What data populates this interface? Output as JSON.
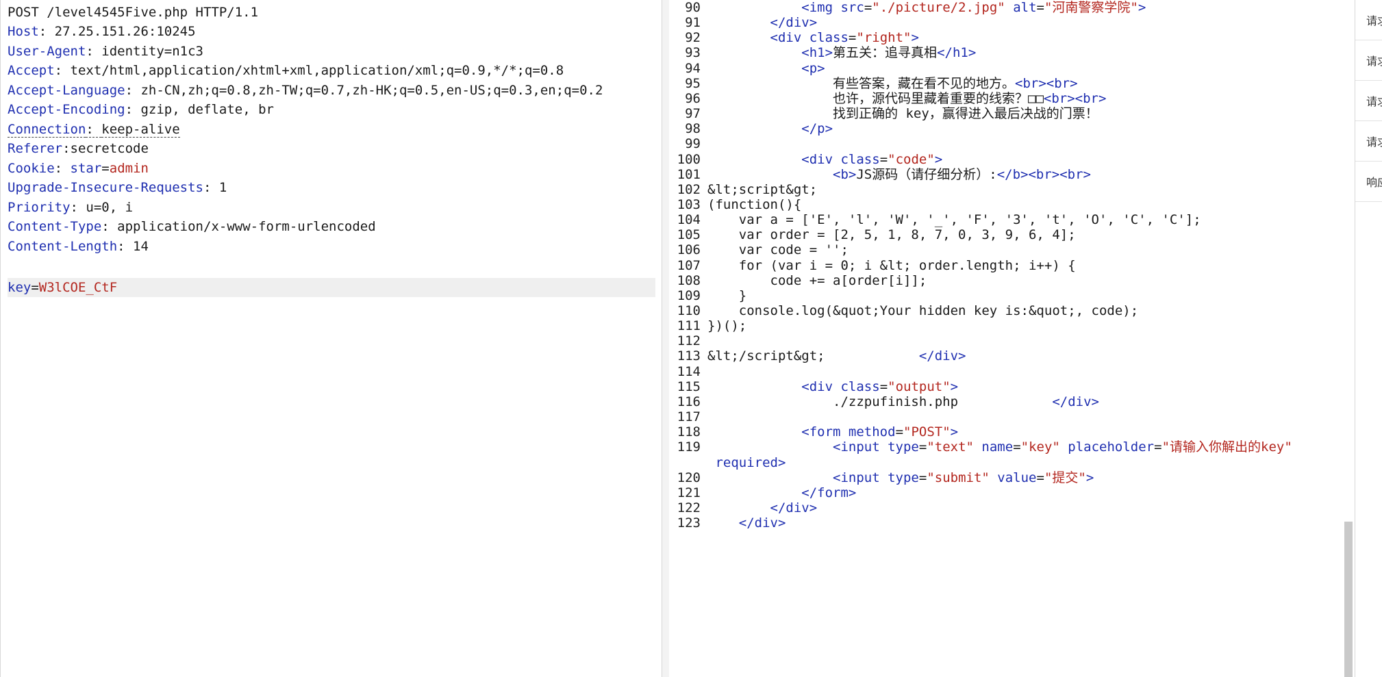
{
  "request": {
    "request_line": "POST /level4545Five.php HTTP/1.1",
    "headers": [
      {
        "name": "Host",
        "sep": ": ",
        "value": "27.25.151.26:10245"
      },
      {
        "name": "User-Agent",
        "sep": ": ",
        "value": "identity=n1c3"
      },
      {
        "name": "Accept",
        "sep": ": ",
        "value": "text/html,application/xhtml+xml,application/xml;q=0.9,*/*;q=0.8"
      },
      {
        "name": "Accept-Language",
        "sep": ": ",
        "value": "zh-CN,zh;q=0.8,zh-TW;q=0.7,zh-HK;q=0.5,en-US;q=0.3,en;q=0.2"
      },
      {
        "name": "Accept-Encoding",
        "sep": ": ",
        "value": "gzip, deflate, br"
      },
      {
        "name": "Connection",
        "sep": ": ",
        "value": "keep-alive"
      },
      {
        "name": "Referer",
        "sep": ":",
        "value": "secretcode"
      },
      {
        "name": "Cookie",
        "sep": ": ",
        "value": "star=admin"
      },
      {
        "name": "Upgrade-Insecure-Requests",
        "sep": ": ",
        "value": "1"
      },
      {
        "name": "Priority",
        "sep": ": ",
        "value": "u=0, i"
      },
      {
        "name": "Content-Type",
        "sep": ": ",
        "value": "application/x-www-form-urlencoded"
      },
      {
        "name": "Content-Length",
        "sep": ": ",
        "value": "14"
      }
    ],
    "body_key": "key",
    "body_sep": "=",
    "body_value": "W3lCOE_CtF"
  },
  "response": {
    "lines": [
      {
        "n": "90",
        "t": [
          [
            "sp",
            "            "
          ],
          [
            "tag",
            "<img "
          ],
          [
            "attr",
            "src"
          ],
          [
            "txt",
            "="
          ],
          [
            "str",
            "\"./picture/2.jpg\""
          ],
          [
            "txt",
            " "
          ],
          [
            "attr",
            "alt"
          ],
          [
            "txt",
            "="
          ],
          [
            "str",
            "\"河南警察学院\""
          ],
          [
            "tag",
            ">"
          ]
        ]
      },
      {
        "n": "91",
        "t": [
          [
            "sp",
            "        "
          ],
          [
            "tag",
            "</div>"
          ]
        ]
      },
      {
        "n": "92",
        "t": [
          [
            "sp",
            "        "
          ],
          [
            "tag",
            "<div "
          ],
          [
            "attr",
            "class"
          ],
          [
            "txt",
            "="
          ],
          [
            "str",
            "\"right\""
          ],
          [
            "tag",
            ">"
          ]
        ]
      },
      {
        "n": "93",
        "t": [
          [
            "sp",
            "            "
          ],
          [
            "tag",
            "<h1>"
          ],
          [
            "txt",
            "第五关：追寻真相"
          ],
          [
            "tag",
            "</h1>"
          ]
        ]
      },
      {
        "n": "94",
        "t": [
          [
            "sp",
            "            "
          ],
          [
            "tag",
            "<p>"
          ]
        ]
      },
      {
        "n": "95",
        "t": [
          [
            "sp",
            "                "
          ],
          [
            "txt",
            "有些答案，藏在看不见的地方。"
          ],
          [
            "tag",
            "<br><br>"
          ]
        ]
      },
      {
        "n": "96",
        "t": [
          [
            "sp",
            "                "
          ],
          [
            "txt",
            "也许，源代码里藏着重要的线索？□□"
          ],
          [
            "tag",
            "<br><br>"
          ]
        ]
      },
      {
        "n": "97",
        "t": [
          [
            "sp",
            "                "
          ],
          [
            "txt",
            "找到正确的 key，赢得进入最后决战的门票！"
          ]
        ]
      },
      {
        "n": "98",
        "t": [
          [
            "sp",
            "            "
          ],
          [
            "tag",
            "</p>"
          ]
        ]
      },
      {
        "n": "99",
        "t": []
      },
      {
        "n": "100",
        "t": [
          [
            "sp",
            "            "
          ],
          [
            "tag",
            "<div "
          ],
          [
            "attr",
            "class"
          ],
          [
            "txt",
            "="
          ],
          [
            "str",
            "\"code\""
          ],
          [
            "tag",
            ">"
          ]
        ]
      },
      {
        "n": "101",
        "t": [
          [
            "sp",
            "                "
          ],
          [
            "tag",
            "<b>"
          ],
          [
            "txt",
            "JS源码（请仔细分析）:"
          ],
          [
            "tag",
            "</b><br><br>"
          ]
        ]
      },
      {
        "n": "102",
        "t": [
          [
            "txt",
            "&lt;script&gt;"
          ]
        ]
      },
      {
        "n": "103",
        "t": [
          [
            "txt",
            "(function(){"
          ]
        ]
      },
      {
        "n": "104",
        "t": [
          [
            "txt",
            "    var a = ['E', 'l', 'W', '_', 'F', '3', 't', 'O', 'C', 'C'];"
          ]
        ]
      },
      {
        "n": "105",
        "t": [
          [
            "txt",
            "    var order = [2, 5, 1, 8, 7, 0, 3, 9, 6, 4];"
          ]
        ]
      },
      {
        "n": "106",
        "t": [
          [
            "txt",
            "    var code = '';"
          ]
        ]
      },
      {
        "n": "107",
        "t": [
          [
            "txt",
            "    for (var i = 0; i &lt; order.length; i++) {"
          ]
        ]
      },
      {
        "n": "108",
        "t": [
          [
            "txt",
            "        code += a[order[i]];"
          ]
        ]
      },
      {
        "n": "109",
        "t": [
          [
            "txt",
            "    }"
          ]
        ]
      },
      {
        "n": "110",
        "t": [
          [
            "txt",
            "    console.log(&quot;Your hidden key is:&quot;, code);"
          ]
        ]
      },
      {
        "n": "111",
        "t": [
          [
            "txt",
            "})();"
          ]
        ]
      },
      {
        "n": "112",
        "t": []
      },
      {
        "n": "113",
        "t": [
          [
            "txt",
            "&lt;/script&gt;            "
          ],
          [
            "tag",
            "</div>"
          ]
        ]
      },
      {
        "n": "114",
        "t": []
      },
      {
        "n": "115",
        "t": [
          [
            "sp",
            "            "
          ],
          [
            "tag",
            "<div "
          ],
          [
            "attr",
            "class"
          ],
          [
            "txt",
            "="
          ],
          [
            "str",
            "\"output\""
          ],
          [
            "tag",
            ">"
          ]
        ]
      },
      {
        "n": "116",
        "t": [
          [
            "sp",
            "                "
          ],
          [
            "txt",
            "./zzpufinish.php            "
          ],
          [
            "tag",
            "</div>"
          ]
        ]
      },
      {
        "n": "117",
        "t": []
      },
      {
        "n": "118",
        "t": [
          [
            "sp",
            "            "
          ],
          [
            "tag",
            "<form "
          ],
          [
            "attr",
            "method"
          ],
          [
            "txt",
            "="
          ],
          [
            "str",
            "\"POST\""
          ],
          [
            "tag",
            ">"
          ]
        ]
      },
      {
        "n": "119",
        "t": [
          [
            "sp",
            "                "
          ],
          [
            "tag",
            "<input "
          ],
          [
            "attr",
            "type"
          ],
          [
            "txt",
            "="
          ],
          [
            "str",
            "\"text\""
          ],
          [
            "txt",
            " "
          ],
          [
            "attr",
            "name"
          ],
          [
            "txt",
            "="
          ],
          [
            "str",
            "\"key\""
          ],
          [
            "txt",
            " "
          ],
          [
            "attr",
            "placeholder"
          ],
          [
            "txt",
            "="
          ],
          [
            "str",
            "\"请输入你解出的key\""
          ]
        ]
      },
      {
        "n": "",
        "t": [
          [
            "sp",
            " "
          ],
          [
            "attr",
            "required"
          ],
          [
            "tag",
            ">"
          ]
        ]
      },
      {
        "n": "120",
        "t": [
          [
            "sp",
            "                "
          ],
          [
            "tag",
            "<input "
          ],
          [
            "attr",
            "type"
          ],
          [
            "txt",
            "="
          ],
          [
            "str",
            "\"submit\""
          ],
          [
            "txt",
            " "
          ],
          [
            "attr",
            "value"
          ],
          [
            "txt",
            "="
          ],
          [
            "str",
            "\"提交\""
          ],
          [
            "tag",
            ">"
          ]
        ]
      },
      {
        "n": "121",
        "t": [
          [
            "sp",
            "            "
          ],
          [
            "tag",
            "</form>"
          ]
        ]
      },
      {
        "n": "122",
        "t": [
          [
            "sp",
            "        "
          ],
          [
            "tag",
            "</div>"
          ]
        ]
      },
      {
        "n": "123",
        "t": [
          [
            "sp",
            "    "
          ],
          [
            "tag",
            "</div>"
          ]
        ]
      }
    ]
  },
  "side_tabs": [
    "请求",
    "请求",
    "请求",
    "请求",
    "响应"
  ]
}
